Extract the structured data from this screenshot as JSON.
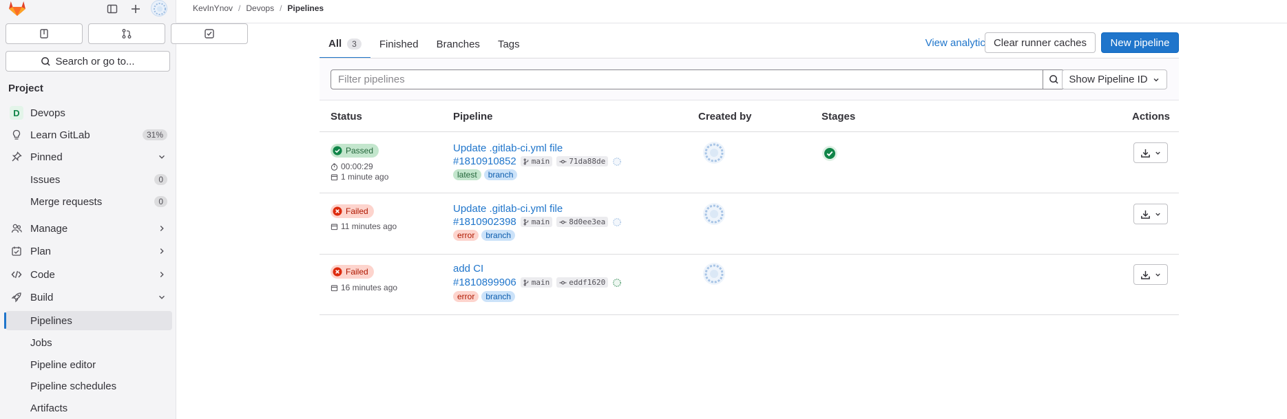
{
  "sidebar": {
    "search_label": "Search or go to...",
    "section_title": "Project",
    "project": {
      "initial": "D",
      "name": "Devops"
    },
    "learn": {
      "label": "Learn GitLab",
      "progress": "31%"
    },
    "pinned": {
      "label": "Pinned"
    },
    "issues": {
      "label": "Issues",
      "count": "0"
    },
    "merge_requests": {
      "label": "Merge requests",
      "count": "0"
    },
    "manage": "Manage",
    "plan": "Plan",
    "code": "Code",
    "build": "Build",
    "pipelines": "Pipelines",
    "jobs": "Jobs",
    "pipeline_editor": "Pipeline editor",
    "pipeline_schedules": "Pipeline schedules",
    "artifacts": "Artifacts"
  },
  "breadcrumb": {
    "user": "KevInYnov",
    "project": "Devops",
    "current": "Pipelines",
    "sep": "/"
  },
  "tabs": {
    "all": "All",
    "all_count": "3",
    "finished": "Finished",
    "branches": "Branches",
    "tags": "Tags"
  },
  "toolbar": {
    "view_analytics": "View analytics",
    "clear_caches": "Clear runner caches",
    "new_pipeline": "New pipeline"
  },
  "filter": {
    "placeholder": "Filter pipelines",
    "show_id": "Show Pipeline ID"
  },
  "table": {
    "headers": {
      "status": "Status",
      "pipeline": "Pipeline",
      "created_by": "Created by",
      "stages": "Stages",
      "actions": "Actions"
    }
  },
  "rows": [
    {
      "status": "Passed",
      "duration": "00:00:29",
      "time": "1 minute ago",
      "title": "Update .gitlab-ci.yml file",
      "id": "#1810910852",
      "branch": "main",
      "commit": "71da88de",
      "tags": [
        "latest",
        "branch"
      ]
    },
    {
      "status": "Failed",
      "time": "11 minutes ago",
      "title": "Update .gitlab-ci.yml file",
      "id": "#1810902398",
      "branch": "main",
      "commit": "8d0ee3ea",
      "tags": [
        "error",
        "branch"
      ]
    },
    {
      "status": "Failed",
      "time": "16 minutes ago",
      "title": "add CI",
      "id": "#1810899906",
      "branch": "main",
      "commit": "eddf1620",
      "tags": [
        "error",
        "branch"
      ]
    }
  ],
  "colors": {
    "accent": "#1f75cb",
    "passed": "#108548",
    "failed": "#dd2b0e",
    "sidebar_bg": "#f4f4f6"
  }
}
